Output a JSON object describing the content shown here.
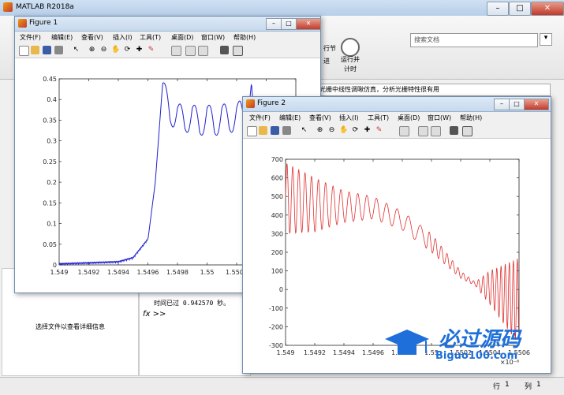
{
  "main_window": {
    "title": "MATLAB R2018a",
    "search_placeholder": "搜索文档",
    "toolstrip": {
      "run_section_label": "行节",
      "advance_label": "进",
      "run_and_time_label_1": "运行并",
      "run_and_time_label_2": "计时"
    },
    "address_bar": "光栅中线性调啾仿真，分析光栅特性很有用",
    "command_window": {
      "output": "时间已过 0.942570 秒。",
      "prompt": "fx >>"
    },
    "file_details_hint": "选择文件以查看详细信息",
    "status_bar": {
      "row_label": "行",
      "row_value": "1",
      "col_label": "列",
      "col_value": "1"
    }
  },
  "figure1": {
    "title": "Figure 1",
    "menu": [
      "文件(F)",
      "编辑(E)",
      "查看(V)",
      "插入(I)",
      "工具(T)",
      "桌面(D)",
      "窗口(W)",
      "帮助(H)"
    ]
  },
  "figure2": {
    "title": "Figure 2",
    "menu": [
      "文件(F)",
      "编辑(E)",
      "查看(V)",
      "插入(I)",
      "工具(T)",
      "桌面(D)",
      "窗口(W)",
      "帮助(H)"
    ]
  },
  "watermark": {
    "text": "必过源码",
    "url": "Biguo100.com"
  },
  "chart_data": [
    {
      "type": "line",
      "color": "#1f1fcf",
      "xlim": [
        1.549,
        1.5506
      ],
      "ylim": [
        0,
        0.45
      ],
      "xticks": [
        "1.549",
        "1.5492",
        "1.5494",
        "1.5496",
        "1.5498",
        "1.55",
        "1.5502",
        "1.5504",
        "1.55"
      ],
      "yticks": [
        "0",
        "0.05",
        "0.1",
        "0.15",
        "0.2",
        "0.25",
        "0.3",
        "0.35",
        "0.4",
        "0.45"
      ],
      "series": [
        {
          "x": [
            1.549,
            1.5494,
            1.5495,
            1.5496,
            1.54965,
            1.5497,
            1.54975,
            1.5498,
            1.54985,
            1.5499,
            1.54995,
            1.55,
            1.55005,
            1.5501,
            1.55015,
            1.5502,
            1.55025,
            1.5503,
            1.55035,
            1.5504,
            1.55045,
            1.5505,
            1.5506
          ],
          "y": [
            0.0,
            0.005,
            0.015,
            0.06,
            0.2,
            0.44,
            0.35,
            0.38,
            0.33,
            0.38,
            0.32,
            0.38,
            0.32,
            0.38,
            0.33,
            0.38,
            0.35,
            0.44,
            0.2,
            0.06,
            0.015,
            0.005,
            0.0
          ]
        }
      ]
    },
    {
      "type": "line",
      "color": "#e03030",
      "xlim": [
        1.549e-06,
        1.5506e-06
      ],
      "ylim": [
        -300,
        700
      ],
      "x_exponent": "×10⁻⁶",
      "xticks": [
        "1.549",
        "1.5492",
        "1.5494",
        "1.5496",
        "1.5498",
        "1.55",
        "1.5502",
        "1.5504",
        "1.5506"
      ],
      "yticks": [
        "-300",
        "-200",
        "-100",
        "0",
        "100",
        "200",
        "300",
        "400",
        "500",
        "600",
        "700"
      ],
      "envelope": {
        "x": [
          1.549,
          1.5492,
          1.5494,
          1.5496,
          1.5498,
          1.55,
          1.5502,
          1.5503,
          1.5504,
          1.5506
        ],
        "upper": [
          680,
          600,
          530,
          500,
          420,
          300,
          100,
          40,
          100,
          170
        ],
        "lower": [
          300,
          310,
          360,
          380,
          320,
          200,
          60,
          20,
          -80,
          -300
        ]
      }
    }
  ]
}
